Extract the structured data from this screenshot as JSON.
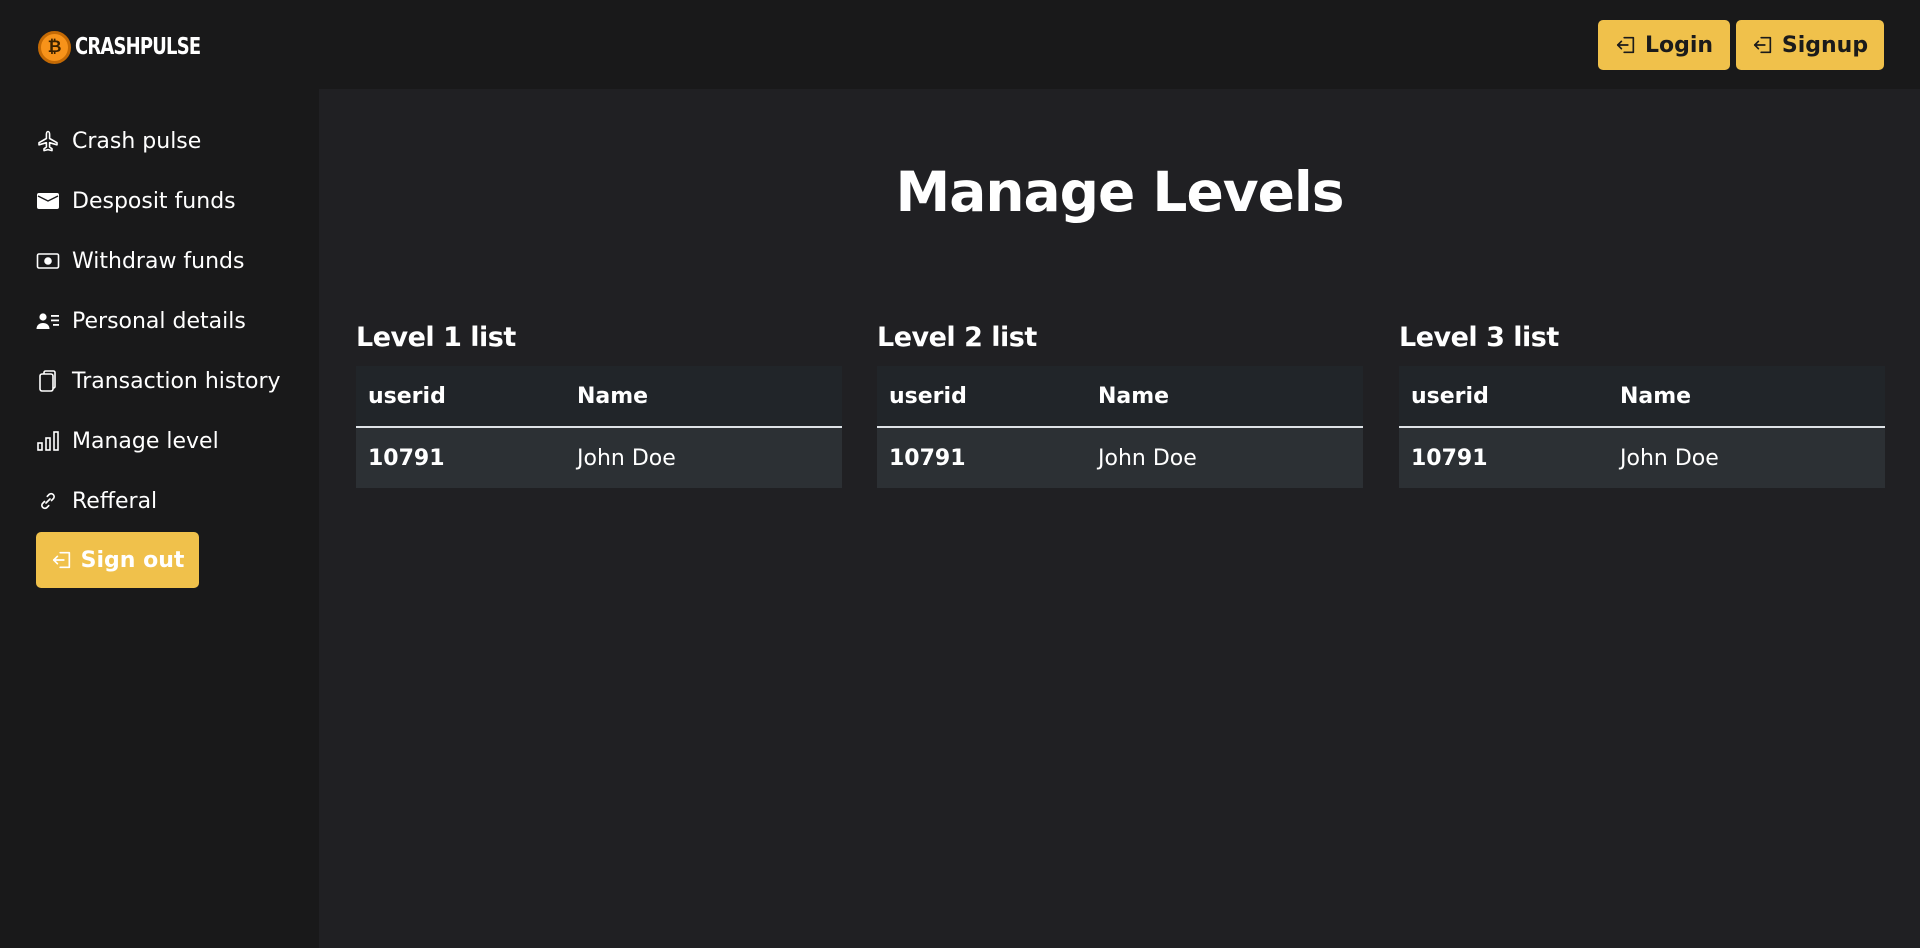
{
  "brand": {
    "name": "CRASHPULSE",
    "coin_symbol": "₿"
  },
  "sidebar": {
    "items": [
      {
        "label": "Crash pulse",
        "icon": "airplane-icon"
      },
      {
        "label": "Desposit funds",
        "icon": "wallet-icon"
      },
      {
        "label": "Withdraw funds",
        "icon": "cash-icon"
      },
      {
        "label": "Personal details",
        "icon": "person-lines-icon"
      },
      {
        "label": "Transaction history",
        "icon": "copy-icon"
      },
      {
        "label": "Manage level",
        "icon": "bar-chart-icon"
      },
      {
        "label": "Refferal",
        "icon": "link-icon"
      }
    ],
    "signout_label": "Sign out"
  },
  "header": {
    "login_label": "Login",
    "signup_label": "Signup"
  },
  "main": {
    "title": "Manage Levels",
    "levels": [
      {
        "title": "Level 1 list",
        "columns": [
          "userid",
          "Name"
        ],
        "rows": [
          [
            "10791",
            "John Doe"
          ]
        ]
      },
      {
        "title": "Level 2 list",
        "columns": [
          "userid",
          "Name"
        ],
        "rows": [
          [
            "10791",
            "John Doe"
          ]
        ]
      },
      {
        "title": "Level 3 list",
        "columns": [
          "userid",
          "Name"
        ],
        "rows": [
          [
            "10791",
            "John Doe"
          ]
        ]
      }
    ]
  },
  "colors": {
    "accent": "#f0c14b",
    "background": "#202023",
    "sidebar": "#19191a",
    "table_header": "#212529",
    "table_row": "#2c3034"
  }
}
